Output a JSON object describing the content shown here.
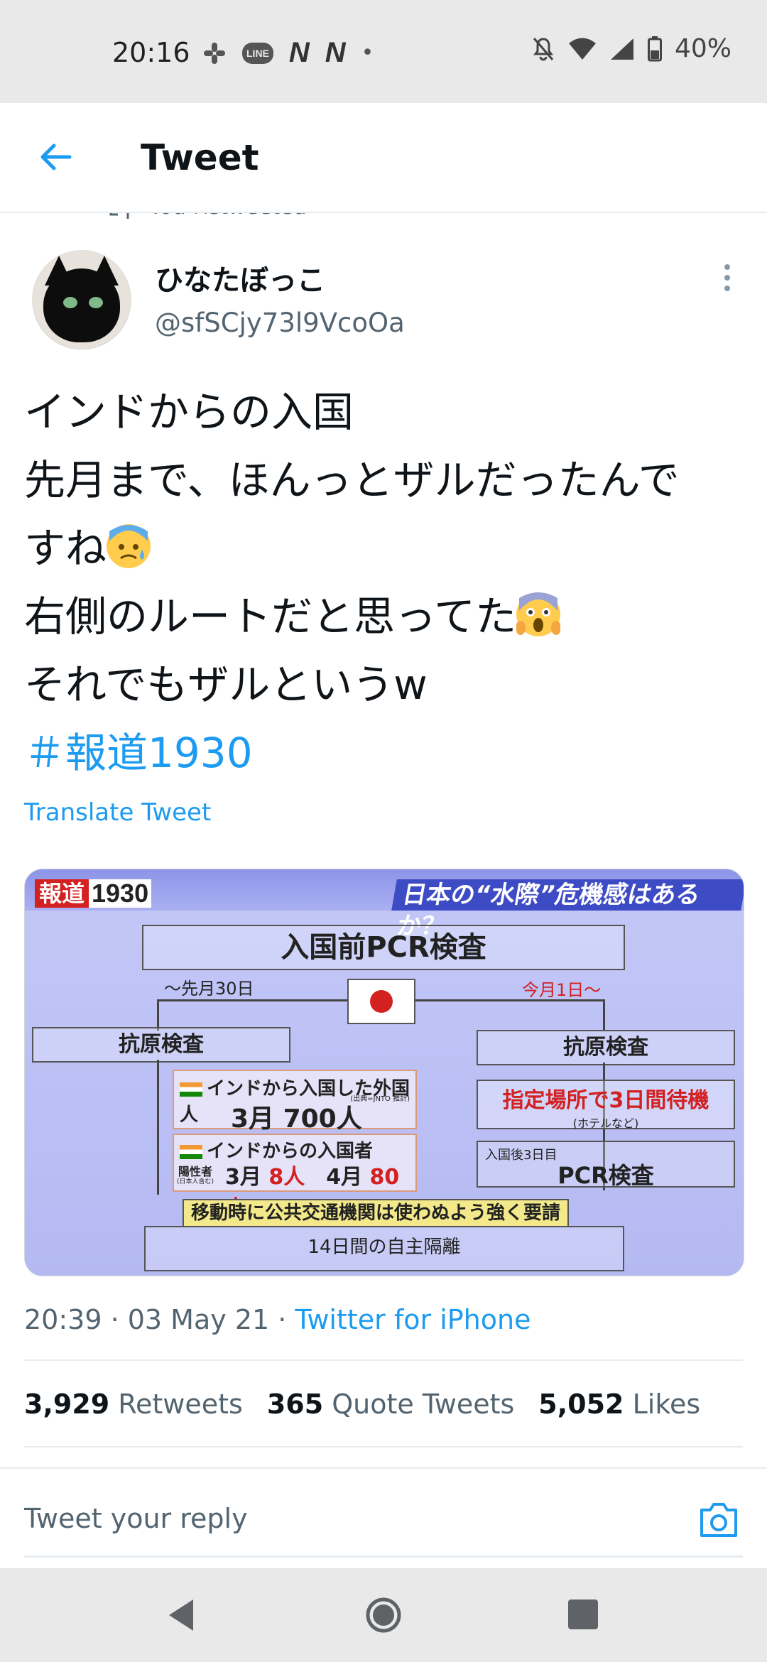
{
  "status_bar": {
    "time": "20:16",
    "battery": "40%",
    "notif_line": "LINE",
    "notif_n1": "N",
    "notif_n2": "N",
    "notif_dot": "•",
    "icons": [
      "slack-icon",
      "line-icon",
      "netflix-icon",
      "netflix-icon",
      "dot-icon",
      "mute-icon",
      "wifi-icon",
      "signal-icon",
      "battery-icon"
    ]
  },
  "header": {
    "title": "Tweet"
  },
  "tweet": {
    "retweeted_label": "You Retweeted",
    "author_name": "ひなたぼっこ",
    "author_handle": "@sfSCjy73l9VcoOa",
    "text_lines": [
      "インドからの入国",
      "先月まで、ほんっとザルだったんで",
      "すね",
      "右側のルートだと思ってた",
      "それでもザルというw"
    ],
    "hashtag": "＃報道1930",
    "translate_label": "Translate Tweet",
    "timestamp": "20:39 · 03 May 21 · ",
    "source": "Twitter for iPhone",
    "stats": {
      "retweets_count": "3,929",
      "retweets_label": "Retweets",
      "quotes_count": "365",
      "quotes_label": "Quote Tweets",
      "likes_count": "5,052",
      "likes_label": "Likes"
    }
  },
  "media": {
    "logo_red": "報道",
    "logo_num": "1930",
    "question": "日本の“水際”危機感はあるか？",
    "pcr_title": "入国前PCR検査",
    "left_label": "〜先月30日",
    "right_label": "今月1日〜",
    "left_antigen": "抗原検査",
    "right_antigen": "抗原検査",
    "foreigners_title": "インドから入国した外国人",
    "foreigners_source": "(出典=JNTO 推計)",
    "foreigners_value": "3月 700人",
    "entrants_title": "インドからの入国者",
    "positive_label": "陽性者",
    "positive_note": "(日本人含む)",
    "march": "3月",
    "march_value": "8人",
    "april": "4月",
    "april_value": "80人",
    "wait_text": "指定場所で3日間待機",
    "wait_sub": "(ホテルなど)",
    "day3_label": "入国後3日目",
    "pcr_test": "PCR検査",
    "banner": "移動時に公共交通機関は使わぬよう強く要請",
    "quarantine": "14日間の自主隔離"
  },
  "reply": {
    "placeholder": "Tweet your reply"
  },
  "nav": {
    "icons": [
      "back-triangle-icon",
      "home-circle-icon",
      "recents-square-icon"
    ]
  },
  "colors": {
    "accent": "#1d9bf0",
    "text_primary": "#0f1419",
    "text_secondary": "#536471",
    "system_bar": "#e9e9e9"
  }
}
